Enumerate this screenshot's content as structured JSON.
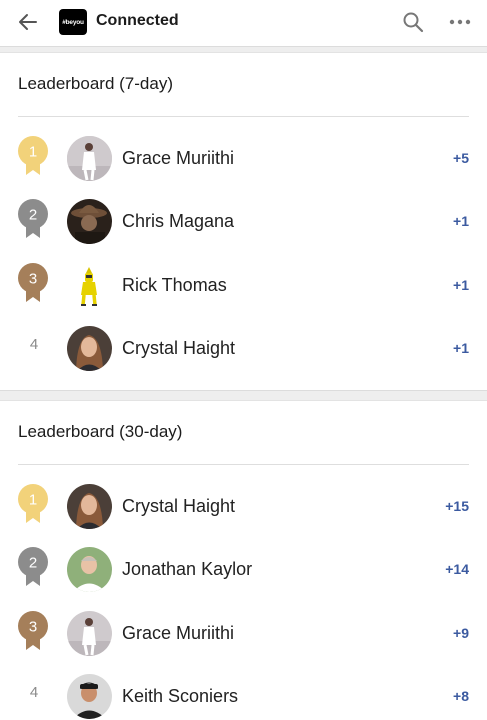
{
  "header": {
    "logo_text": "#beyou",
    "title": "Connected",
    "icons": {
      "back": "arrow-left-icon",
      "search": "search-icon",
      "more": "more-horizontal-icon"
    }
  },
  "colors": {
    "gold": "#f2d27a",
    "silver": "#8c8c8c",
    "bronze": "#a57f5a",
    "score_blue": "#3b5aa0"
  },
  "leaderboards": [
    {
      "title": "Leaderboard (7-day)",
      "entries": [
        {
          "rank": "1",
          "medal": "gold",
          "name": "Grace Muriithi",
          "score": "+5"
        },
        {
          "rank": "2",
          "medal": "silver",
          "name": "Chris Magana",
          "score": "+1"
        },
        {
          "rank": "3",
          "medal": "bronze",
          "name": "Rick Thomas",
          "score": "+1"
        },
        {
          "rank": "4",
          "medal": "none",
          "name": "Crystal Haight",
          "score": "+1"
        }
      ]
    },
    {
      "title": "Leaderboard (30-day)",
      "entries": [
        {
          "rank": "1",
          "medal": "gold",
          "name": "Crystal Haight",
          "score": "+15"
        },
        {
          "rank": "2",
          "medal": "silver",
          "name": "Jonathan Kaylor",
          "score": "+14"
        },
        {
          "rank": "3",
          "medal": "bronze",
          "name": "Grace Muriithi",
          "score": "+9"
        },
        {
          "rank": "4",
          "medal": "none",
          "name": "Keith Sconiers",
          "score": "+8"
        }
      ]
    }
  ]
}
